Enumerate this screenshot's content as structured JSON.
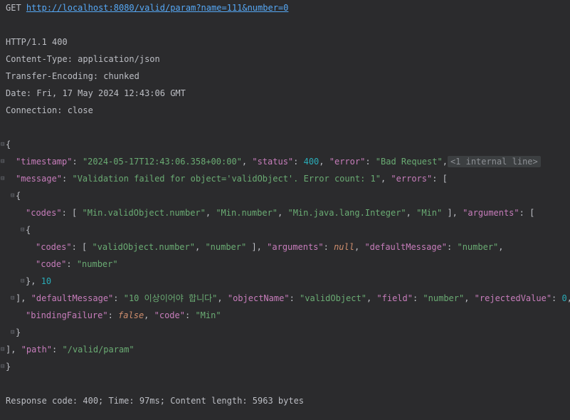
{
  "request": {
    "method": "GET",
    "url": "http://localhost:8080/valid/param?name=111&number=0"
  },
  "headers": [
    "HTTP/1.1 400",
    "Content-Type: application/json",
    "Transfer-Encoding: chunked",
    "Date: Fri, 17 May 2024 12:43:06 GMT",
    "Connection: close"
  ],
  "body": {
    "open_brace": "{",
    "timestamp_key": "\"timestamp\"",
    "timestamp_val": "\"2024-05-17T12:43:06.358+00:00\"",
    "status_key": "\"status\"",
    "status_val": "400",
    "error_key": "\"error\"",
    "error_val": "\"Bad Request\"",
    "folded_label": "<1 internal line>",
    "message_key": "\"message\"",
    "message_val": "\"Validation failed for object='validObject'. Error count: 1\"",
    "errors_key": "\"errors\"",
    "codes_key": "\"codes\"",
    "codes1": "\"Min.validObject.number\"",
    "codes2": "\"Min.number\"",
    "codes3": "\"Min.java.lang.Integer\"",
    "codes4": "\"Min\"",
    "arguments_key": "\"arguments\"",
    "inner_codes1": "\"validObject.number\"",
    "inner_codes2": "\"number\"",
    "null_val": "null",
    "defaultMessage_key": "\"defaultMessage\"",
    "inner_default_val": "\"number\"",
    "code_key": "\"code\"",
    "inner_code_val": "\"number\"",
    "arg_num": "10",
    "default_val": "\"10 이상이어야 합니다\"",
    "objectName_key": "\"objectName\"",
    "objectName_val": "\"validObject\"",
    "field_key": "\"field\"",
    "field_val": "\"number\"",
    "rejected_key": "\"rejectedValue\"",
    "rejected_val": "0",
    "binding_key": "\"bindingFailure\"",
    "false_val": "false",
    "code_val": "\"Min\"",
    "path_key": "\"path\"",
    "path_val": "\"/valid/param\"",
    "close_brace": "}"
  },
  "footer": "Response code: 400; Time: 97ms; Content length: 5963 bytes"
}
